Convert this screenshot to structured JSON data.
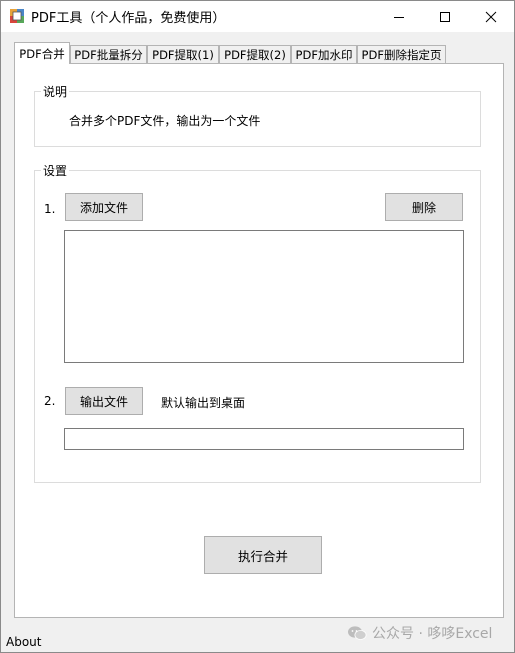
{
  "window": {
    "title": "PDF工具（个人作品，免费使用）",
    "controls": [
      "minimize-icon",
      "maximize-icon",
      "close-icon"
    ]
  },
  "tabs": [
    {
      "label": "PDF合并",
      "active": true
    },
    {
      "label": "PDF批量拆分",
      "active": false
    },
    {
      "label": "PDF提取(1)",
      "active": false
    },
    {
      "label": "PDF提取(2)",
      "active": false
    },
    {
      "label": "PDF加水印",
      "active": false
    },
    {
      "label": "PDF删除指定页",
      "active": false
    }
  ],
  "description": {
    "legend": "说明",
    "text": "合并多个PDF文件，输出为一个文件"
  },
  "settings": {
    "legend": "设置",
    "step1": "1.",
    "add_button": "添加文件",
    "delete_button": "删除",
    "files": [],
    "step2": "2.",
    "output_button": "输出文件",
    "output_hint": "默认输出到桌面",
    "output_path": ""
  },
  "execute_button": "执行合并",
  "status": "About",
  "watermark": {
    "text": "公众号 · 哆哆Excel",
    "icon": "wechat-icon"
  }
}
